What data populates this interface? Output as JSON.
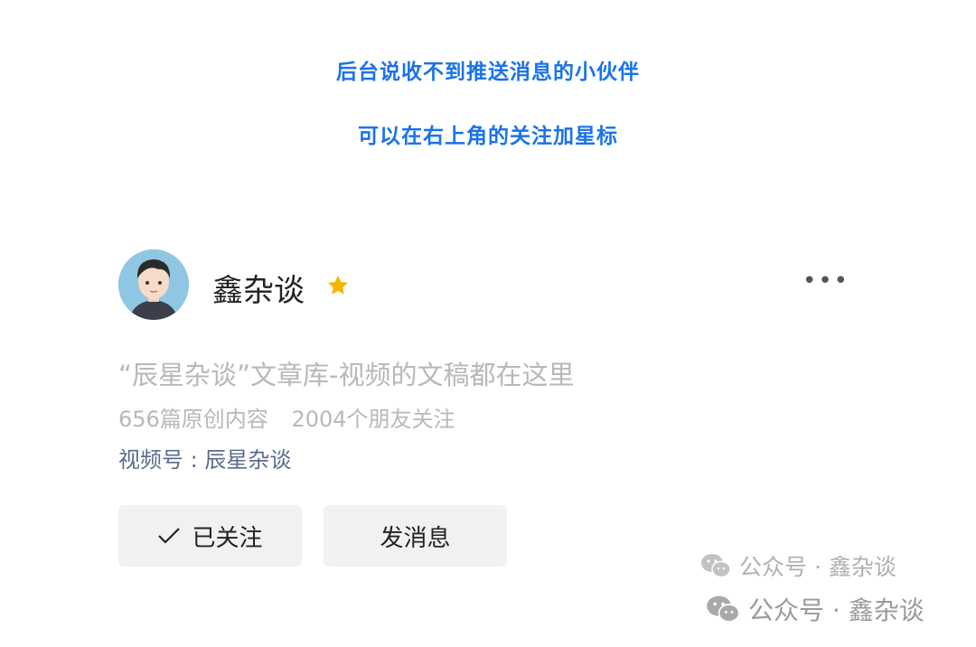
{
  "notice": {
    "line1": "后台说收不到推送消息的小伙伴",
    "line2": "可以在右上角的关注加星标"
  },
  "profile": {
    "name": "鑫杂谈",
    "description": "“辰星杂谈”文章库-视频的文稿都在这里",
    "original_count": "656篇原创内容",
    "friends_following": "2004个朋友关注",
    "video_channel": "视频号 : 辰星杂谈",
    "more_label": "•••"
  },
  "actions": {
    "follow_label": "已关注",
    "message_label": "发消息"
  },
  "watermarks": [
    {
      "text": "公众号 · 鑫杂谈"
    },
    {
      "text": "公众号 · 鑫杂谈"
    }
  ],
  "colors": {
    "notice": "#1a73e8",
    "star": "#f7b500",
    "channel": "#5b6b8c"
  }
}
